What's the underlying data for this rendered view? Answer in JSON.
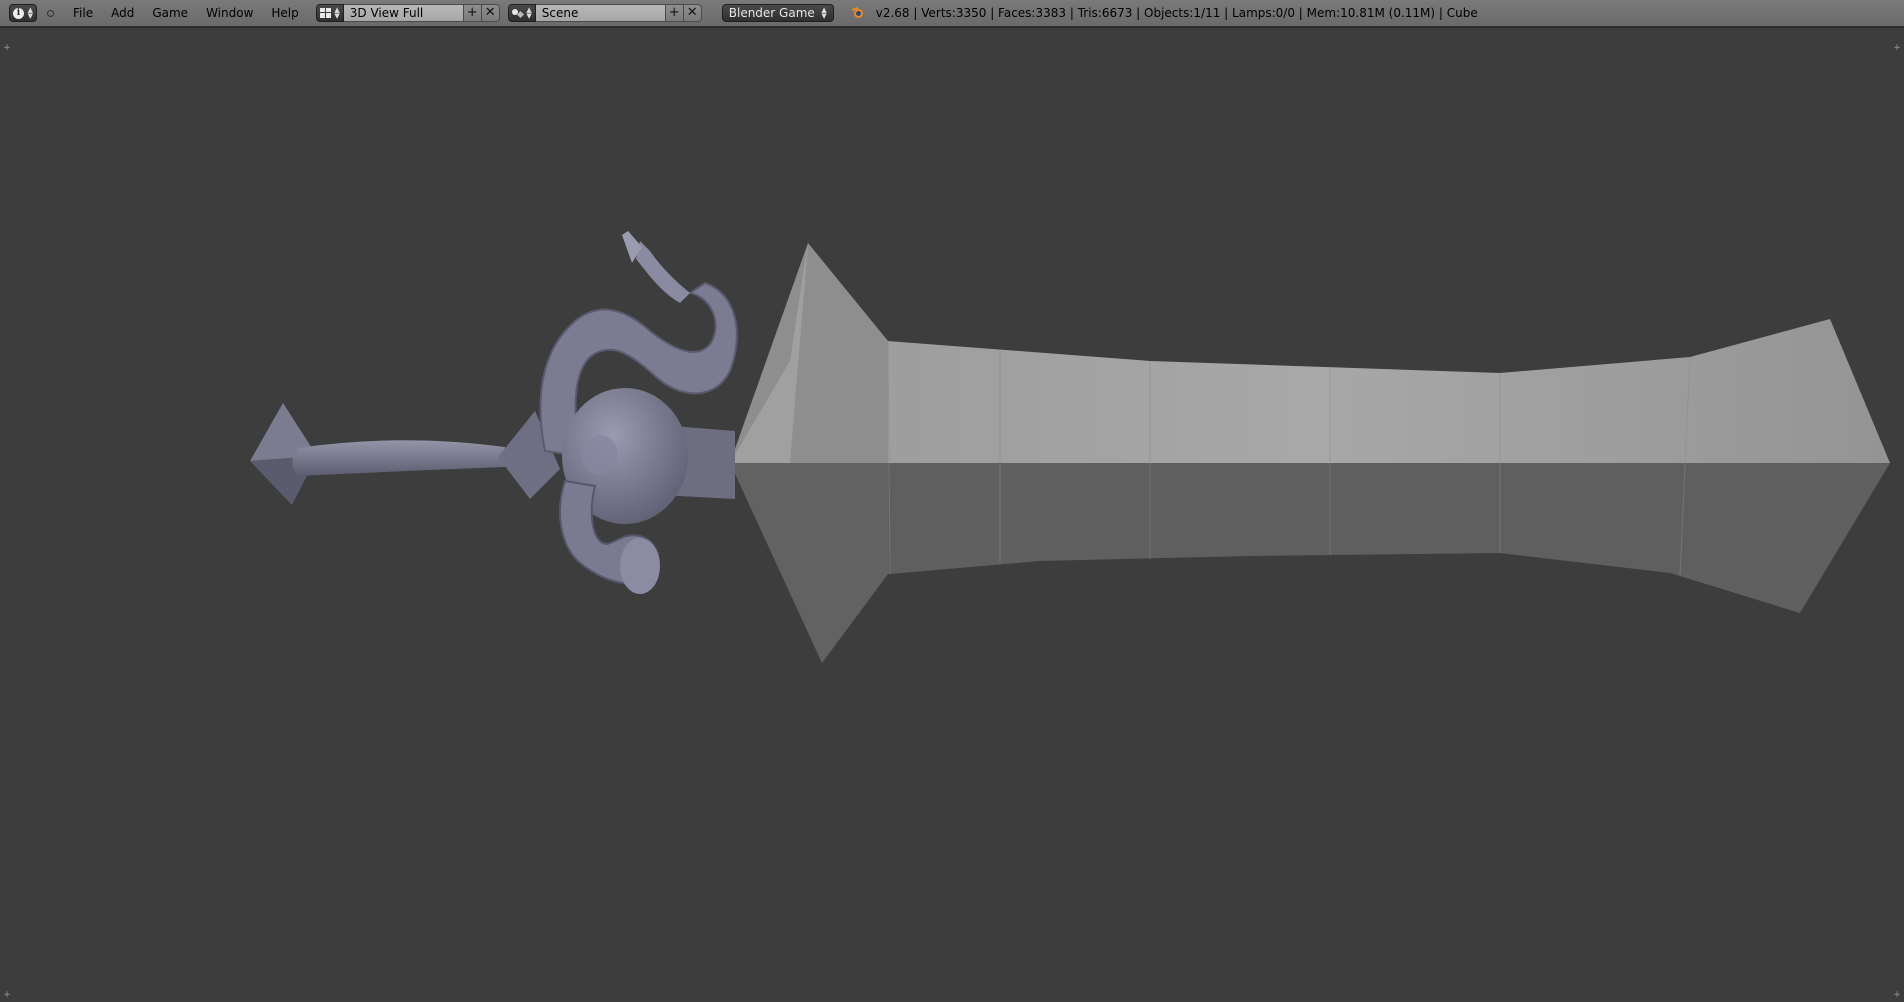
{
  "header": {
    "menu": [
      "File",
      "Add",
      "Game",
      "Window",
      "Help"
    ],
    "screen_layout": "3D View Full",
    "scene": "Scene",
    "render_engine": "Blender Game",
    "stats": "v2.68 | Verts:3350 | Faces:3383 | Tris:6673 | Objects:1/11 | Lamps:0/0 | Mem:10.81M (0.11M) | Cube",
    "add_symbol": "+",
    "remove_symbol": "✕"
  },
  "icons": {
    "editor_type": "info-icon",
    "screen_layout": "layout-grid-icon",
    "scene": "scene-icon",
    "engine": "blender-logo-icon"
  },
  "colors": {
    "header_bg": "#727272",
    "viewport_bg": "#3d3d3d",
    "blade_light": "#9a9a9a",
    "blade_dark": "#5e5e5e",
    "hilt": "#7a7b90"
  }
}
